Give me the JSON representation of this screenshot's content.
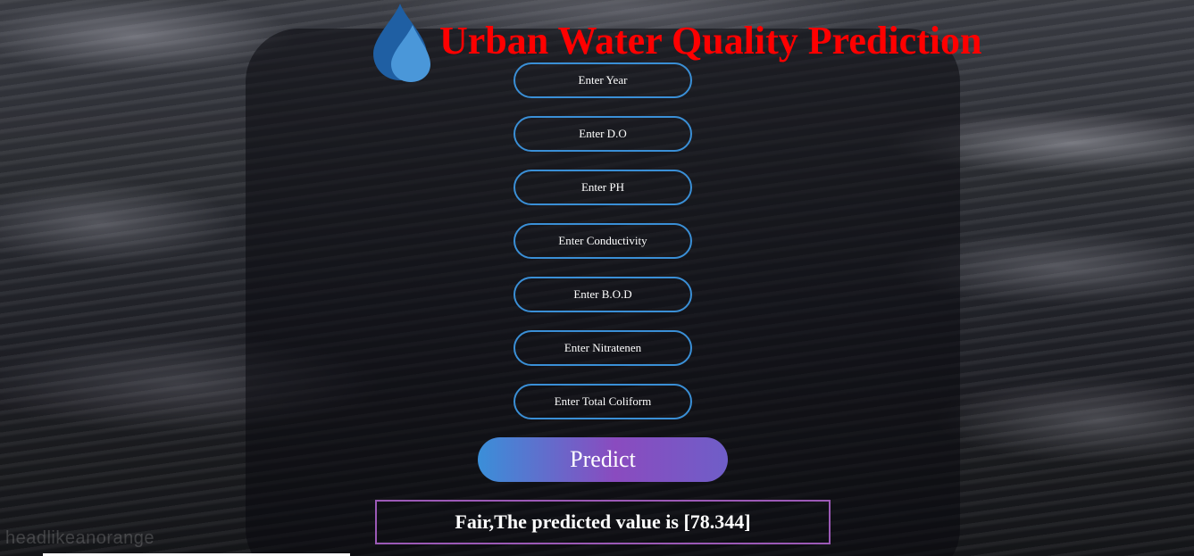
{
  "header": {
    "title": "Urban Water Quality Prediction",
    "logo_icon": "water-drops-icon"
  },
  "form": {
    "fields": [
      {
        "placeholder": "Enter Year"
      },
      {
        "placeholder": "Enter D.O"
      },
      {
        "placeholder": "Enter PH"
      },
      {
        "placeholder": "Enter Conductivity"
      },
      {
        "placeholder": "Enter B.O.D"
      },
      {
        "placeholder": "Enter Nitratenen"
      },
      {
        "placeholder": "Enter Total Coliform"
      }
    ],
    "predict_label": "Predict"
  },
  "result": {
    "text": "Fair,The predicted value is [78.344]"
  },
  "background": {
    "watermark": "headlikeanorange"
  },
  "colors": {
    "title": "#ff0000",
    "field_border": "#3a8fd6",
    "result_border": "#9b59b6",
    "button_gradient_start": "#3a8fd9",
    "button_gradient_end": "#8a4bbf"
  }
}
